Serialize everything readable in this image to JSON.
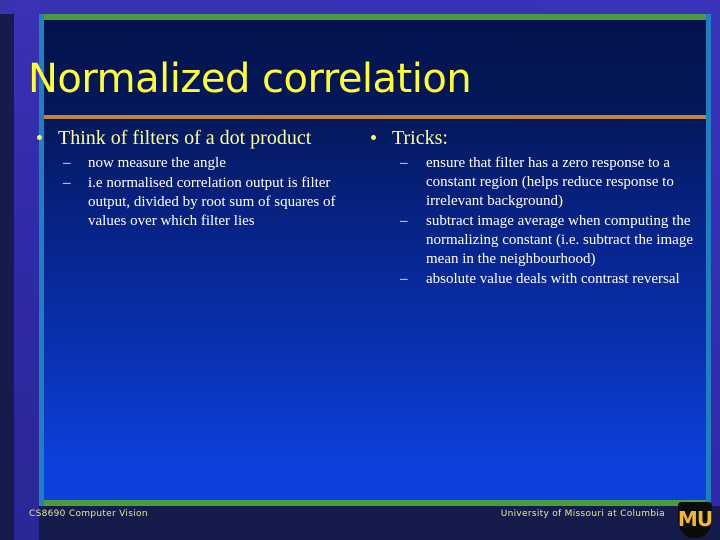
{
  "slide": {
    "title": "Normalized correlation",
    "colors": {
      "title_text": "#ffff33",
      "level1_text": "#ffff99",
      "level2_text": "#ffffff",
      "rule": "#c2843c",
      "frame_green": "#4a9c3e",
      "frame_cyan": "#1f7fc0",
      "band_purple": "#3832b6",
      "footer_text": "#e8e89a",
      "logo_gold": "#f1b82d"
    },
    "columns": [
      {
        "id": "left",
        "bullets": [
          {
            "text": "Think of filters of a dot product",
            "sub": [
              "now measure the angle",
              "i.e normalised correlation output is filter output, divided by root sum of squares of values over which filter lies"
            ]
          }
        ]
      },
      {
        "id": "right",
        "bullets": [
          {
            "text": "Tricks:",
            "sub": [
              "ensure that filter has a zero response to a constant region (helps reduce response to irrelevant background)",
              "subtract image average when computing the normalizing constant (i.e. subtract the image mean in the neighbourhood)",
              "absolute value deals with contrast reversal"
            ]
          }
        ]
      }
    ],
    "footer": {
      "left": "CS8690 Computer Vision",
      "right": "University of Missouri at Columbia",
      "logo_label": "MU",
      "logo_name": "mu-shield-logo"
    }
  }
}
